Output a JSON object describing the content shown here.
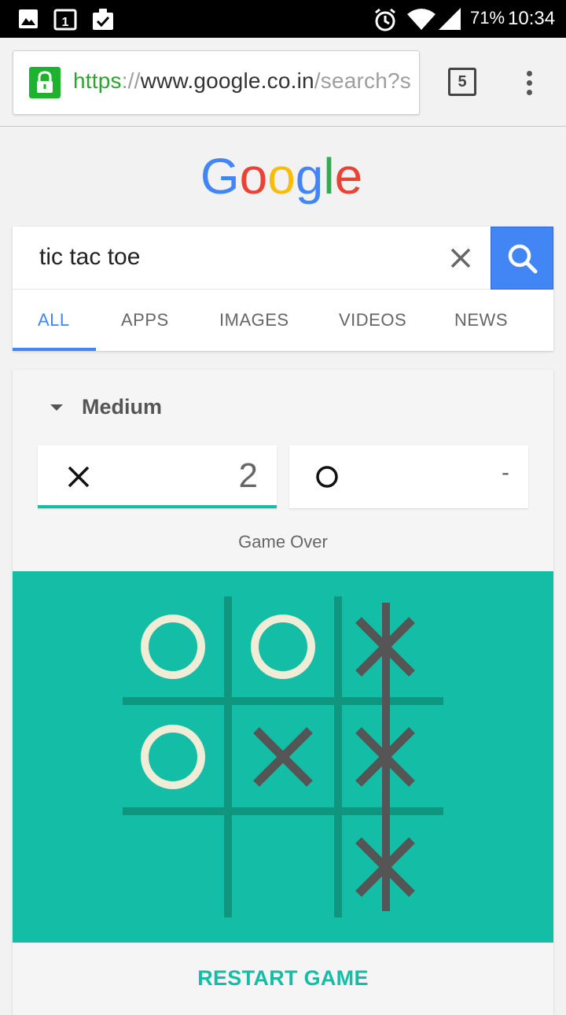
{
  "status_bar": {
    "battery": "71%",
    "time": "10:34",
    "icons": [
      "image-icon",
      "calendar-icon",
      "clipboard-check-icon",
      "alarm-icon",
      "wifi-icon",
      "signal-icon"
    ]
  },
  "browser": {
    "url_scheme": "https",
    "url_sep": "://",
    "url_host": "www.google.co.in",
    "url_path": "/search?s",
    "tab_count": "5",
    "secure_color": "#1db32f"
  },
  "logo_text": "Google",
  "search": {
    "query": "tic tac toe",
    "tabs": [
      {
        "label": "ALL",
        "active": true
      },
      {
        "label": "APPS"
      },
      {
        "label": "IMAGES"
      },
      {
        "label": "VIDEOS"
      },
      {
        "label": "NEWS"
      }
    ],
    "accent": "#4285f4"
  },
  "game": {
    "difficulty": "Medium",
    "player_x_score": "2",
    "player_o_score": "-",
    "status": "Game Over",
    "restart_label": "RESTART GAME",
    "board": [
      [
        "O",
        "O",
        "X"
      ],
      [
        "O",
        "X",
        "X"
      ],
      [
        "",
        "",
        "X"
      ]
    ],
    "winning_line": "column 3",
    "board_color": "#14bda5"
  }
}
